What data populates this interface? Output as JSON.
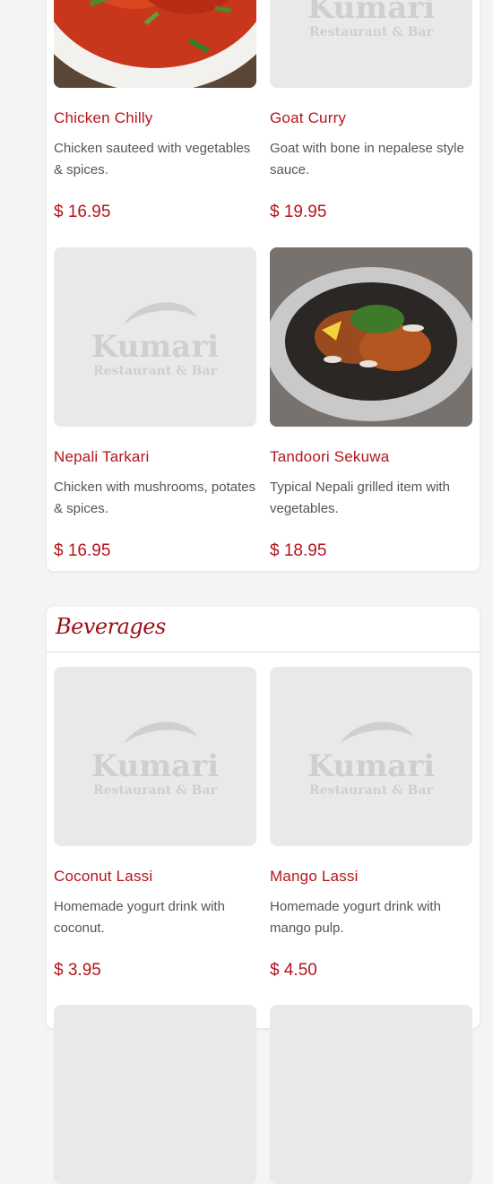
{
  "placeholder_logo": {
    "brand": "Kumari",
    "subtitle": "Restaurant & Bar"
  },
  "colors": {
    "accent": "#b6141b",
    "heading": "#9e0f14",
    "placeholder_bg": "#e9e9e9",
    "placeholder_fg": "#cfcfcf"
  },
  "menu_section": {
    "items": [
      {
        "name": "Chicken Chilly",
        "description": "Chicken sauteed with vegetables & spices.",
        "price": "$ 16.95",
        "image": "photo"
      },
      {
        "name": "Goat Curry",
        "description": "Goat with bone in nepalese style sauce.",
        "price": "$ 19.95",
        "image": "placeholder"
      },
      {
        "name": "Nepali Tarkari",
        "description": "Chicken with mushrooms, potates & spices.",
        "price": "$ 16.95",
        "image": "placeholder"
      },
      {
        "name": "Tandoori Sekuwa",
        "description": "Typical Nepali grilled item with vegetables.",
        "price": "$ 18.95",
        "image": "photo"
      }
    ]
  },
  "beverages": {
    "title": "Beverages",
    "items": [
      {
        "name": "Coconut Lassi",
        "description": "Homemade yogurt drink with coconut.",
        "price": "$ 3.95",
        "image": "placeholder"
      },
      {
        "name": "Mango Lassi",
        "description": "Homemade yogurt drink with mango pulp.",
        "price": "$ 4.50",
        "image": "placeholder"
      }
    ]
  }
}
